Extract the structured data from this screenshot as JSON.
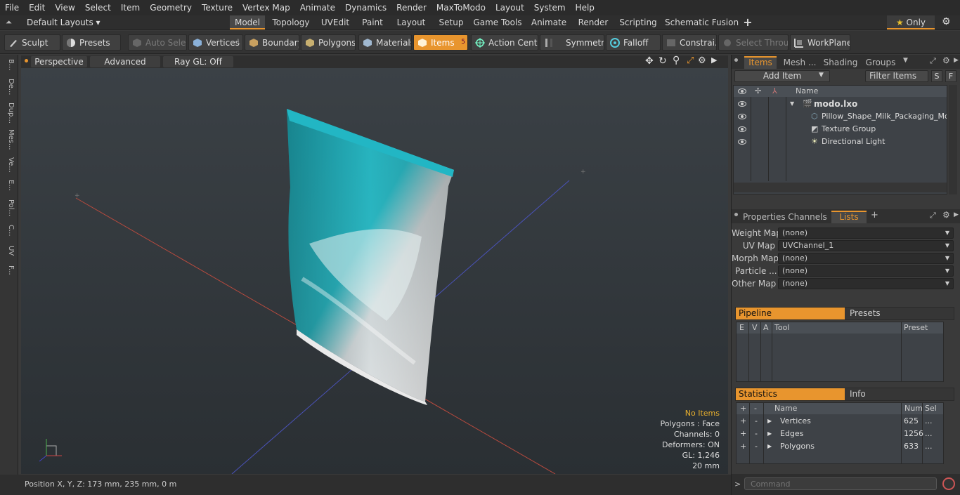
{
  "menubar": [
    "File",
    "Edit",
    "View",
    "Select",
    "Item",
    "Geometry",
    "Texture",
    "Vertex Map",
    "Animate",
    "Dynamics",
    "Render",
    "MaxToModo",
    "Layout",
    "System",
    "Help"
  ],
  "layouts": {
    "default_label": "Default Layouts",
    "tabs": [
      "Model",
      "Topology",
      "UVEdit",
      "Paint",
      "Layout",
      "Setup",
      "Game Tools",
      "Animate",
      "Render",
      "Scripting",
      "Schematic Fusion"
    ],
    "active": "Model",
    "add": "+",
    "only_label": "Only"
  },
  "toolbar": {
    "sculpt": "Sculpt",
    "presets": "Presets",
    "auto_select": "Auto Select",
    "vertices": "Vertices",
    "vertices_count": "1",
    "boundary": "Boundary",
    "polygons": "Polygons",
    "materials": "Materials",
    "items": "Items",
    "items_count": "5",
    "action_center": "Action Center",
    "symmetry": "Symmetry",
    "falloff": "Falloff",
    "constraints": "Constrai...",
    "select_through": "Select Through",
    "workplane": "WorkPlane"
  },
  "left_tabs": [
    "B...",
    "De...",
    "Dup...",
    "Mes...",
    "Ve...",
    "E...",
    "Pol...",
    "C...",
    "UV",
    "F..."
  ],
  "viewport": {
    "perspective": "Perspective",
    "advanced": "Advanced",
    "raygl": "Ray GL: Off",
    "info": {
      "no_items": "No Items",
      "polygons": "Polygons : Face",
      "channels": "Channels: 0",
      "deformers": "Deformers: ON",
      "gl": "GL: 1,246",
      "scale": "20 mm"
    }
  },
  "status": {
    "position": "Position X, Y, Z:   173 mm, 235 mm, 0 m"
  },
  "items_panel": {
    "tabs": [
      "Items",
      "Mesh ...",
      "Shading",
      "Groups"
    ],
    "add_item": "Add Item",
    "filter": "Filter Items",
    "s_btn": "S",
    "f_btn": "F",
    "name_header": "Name",
    "tree": [
      {
        "label": "modo.lxo"
      },
      {
        "label": "Pillow_Shape_Milk_Packaging_Moc..."
      },
      {
        "label": "Texture Group"
      },
      {
        "label": "Directional Light"
      }
    ]
  },
  "props_panel": {
    "tabs": [
      "Properties",
      "Channels",
      "Lists"
    ],
    "add": "+",
    "maps": [
      {
        "label": "Weight Map",
        "value": "(none)"
      },
      {
        "label": "UV Map",
        "value": "UVChannel_1"
      },
      {
        "label": "Morph Map",
        "value": "(none)"
      },
      {
        "label": "Particle   ...",
        "value": "(none)"
      },
      {
        "label": "Other Map",
        "value": "(none)"
      }
    ],
    "pipeline": "Pipeline",
    "presets": "Presets",
    "pipe_cols": [
      "E",
      "V",
      "A",
      "Tool",
      "Preset"
    ],
    "statistics": "Statistics",
    "info": "Info",
    "stat_cols": [
      "+",
      "-",
      "Name",
      "Num",
      "Sel"
    ],
    "stats": [
      {
        "name": "Vertices",
        "num": "625",
        "sel": "..."
      },
      {
        "name": "Edges",
        "num": "1256",
        "sel": "..."
      },
      {
        "name": "Polygons",
        "num": "633",
        "sel": "..."
      }
    ],
    "command_placeholder": "Command"
  },
  "colors": {
    "accent": "#e8952e",
    "teal": "#1fb0bd"
  }
}
